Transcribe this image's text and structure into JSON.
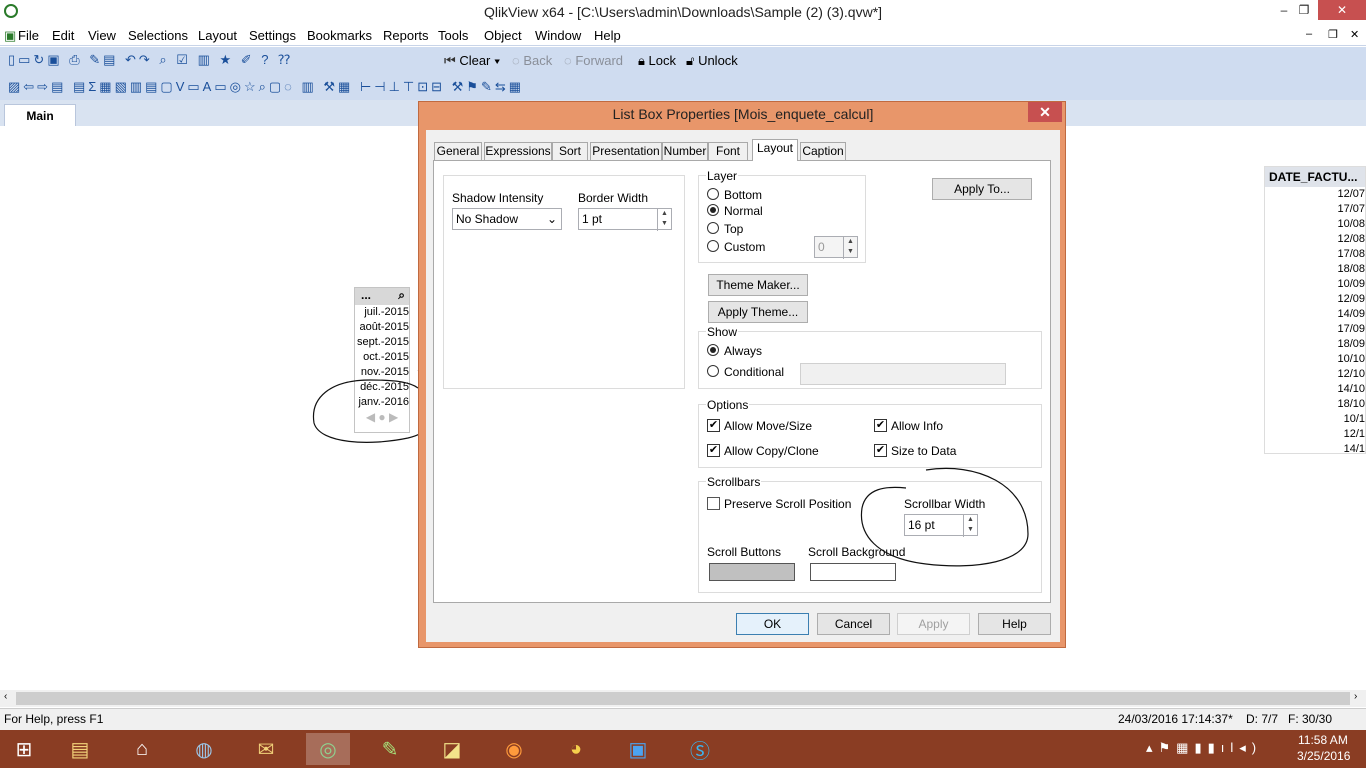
{
  "window": {
    "title": "QlikView x64 - [C:\\Users\\admin\\Downloads\\Sample (2) (3).qvw*]",
    "minimize": "‒",
    "restore": "❐",
    "close": "✕"
  },
  "menu": {
    "items": [
      "File",
      "Edit",
      "View",
      "Selections",
      "Layout",
      "Settings",
      "Bookmarks",
      "Reports",
      "Tools",
      "Object",
      "Window",
      "Help"
    ]
  },
  "toolbar": {
    "clear": "Clear",
    "back": "Back",
    "forward": "Forward",
    "lock": "Lock",
    "unlock": "Unlock"
  },
  "sheet_tab": {
    "label": "Main"
  },
  "listbox": {
    "caption": "...",
    "values": [
      "juil.-2015",
      "août-2015",
      "sept.-2015",
      "oct.-2015",
      "nov.-2015",
      "déc.-2015",
      "janv.-2016"
    ]
  },
  "table": {
    "header": "DATE_FACTU...",
    "cells": [
      "12/07",
      "17/07",
      "10/08",
      "12/08",
      "17/08",
      "18/08",
      "10/09",
      "12/09",
      "14/09",
      "17/09",
      "18/09",
      "10/10",
      "12/10",
      "14/10",
      "18/10",
      "10/1",
      "12/1",
      "14/1"
    ]
  },
  "dialog": {
    "title": "List Box Properties [Mois_enquete_calcul]",
    "close": "✕",
    "tabs": [
      "General",
      "Expressions",
      "Sort",
      "Presentation",
      "Number",
      "Font",
      "Layout",
      "Caption"
    ],
    "active_tab": "Layout",
    "shadow_label": "Shadow Intensity",
    "shadow_value": "No Shadow",
    "border_label": "Border Width",
    "border_value": "1 pt",
    "layer": {
      "title": "Layer",
      "options": [
        "Bottom",
        "Normal",
        "Top",
        "Custom"
      ],
      "selected": "Normal",
      "custom_value": "0"
    },
    "apply_to": "Apply To...",
    "theme_maker": "Theme Maker...",
    "apply_theme": "Apply Theme...",
    "show": {
      "title": "Show",
      "options": [
        "Always",
        "Conditional"
      ],
      "selected": "Always"
    },
    "options": {
      "title": "Options",
      "allow_move": "Allow Move/Size",
      "allow_info": "Allow Info",
      "allow_copy": "Allow Copy/Clone",
      "size_to_data": "Size to Data"
    },
    "scrollbars": {
      "title": "Scrollbars",
      "preserve": "Preserve Scroll Position",
      "width_label": "Scrollbar Width",
      "width_value": "16 pt",
      "buttons_label": "Scroll Buttons",
      "background_label": "Scroll Background",
      "buttons_color": "#c0c0c0",
      "background_color": "#ffffff"
    },
    "buttons": {
      "ok": "OK",
      "cancel": "Cancel",
      "apply": "Apply",
      "help": "Help"
    }
  },
  "status": {
    "help": "For Help, press F1",
    "timestamp": "24/03/2016 17:14:37*",
    "d": "D: 7/7",
    "f": "F: 30/30"
  },
  "clock": {
    "time": "11:58 AM",
    "date": "3/25/2016"
  },
  "colors": {
    "dialog_frame": "#e8966a",
    "taskbar": "#8a3d23",
    "toolbar": "#cfdcf0"
  }
}
